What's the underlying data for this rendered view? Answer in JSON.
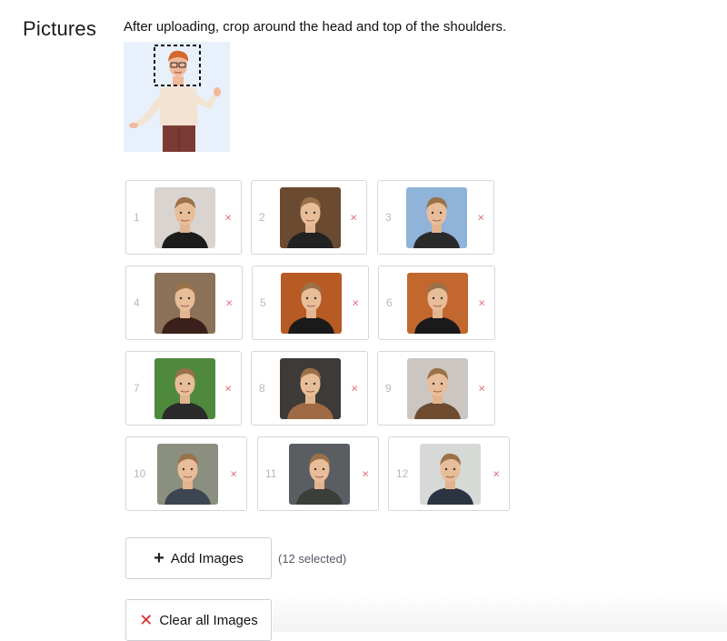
{
  "section": {
    "label": "Pictures"
  },
  "instruction": "After uploading, crop around the head and top of the shoulders.",
  "example": {
    "alt": "example-crop-illustration"
  },
  "slots": [
    {
      "number": "1",
      "remove": "×",
      "bg": "#d9d4cf",
      "shirt": "#1c1c1c"
    },
    {
      "number": "2",
      "remove": "×",
      "bg": "#6b4a32",
      "shirt": "#222222"
    },
    {
      "number": "3",
      "remove": "×",
      "bg": "#8fb3d9",
      "shirt": "#2a2a2a"
    },
    {
      "number": "4",
      "remove": "×",
      "bg": "#8a7158",
      "shirt": "#3a1f1a"
    },
    {
      "number": "5",
      "remove": "×",
      "bg": "#b85a24",
      "shirt": "#1a1a1a"
    },
    {
      "number": "6",
      "remove": "×",
      "bg": "#c2672e",
      "shirt": "#1a1a1a"
    },
    {
      "number": "7",
      "remove": "×",
      "bg": "#4f8a3c",
      "shirt": "#2b2b2b"
    },
    {
      "number": "8",
      "remove": "×",
      "bg": "#3d3a37",
      "shirt": "#a06a44"
    },
    {
      "number": "9",
      "remove": "×",
      "bg": "#cbc6c2",
      "shirt": "#6e4b2e"
    },
    {
      "number": "10",
      "remove": "×",
      "bg": "#8a8f80",
      "shirt": "#3d4650"
    },
    {
      "number": "11",
      "remove": "×",
      "bg": "#5a5e63",
      "shirt": "#3b3f3a"
    },
    {
      "number": "12",
      "remove": "×",
      "bg": "#d7d9d6",
      "shirt": "#2b3440"
    }
  ],
  "actions": {
    "add_label": "Add Images",
    "add_icon": "plus-icon",
    "selected_count": "(12 selected)",
    "clear_label": "Clear all Images",
    "clear_icon": "close-icon"
  }
}
